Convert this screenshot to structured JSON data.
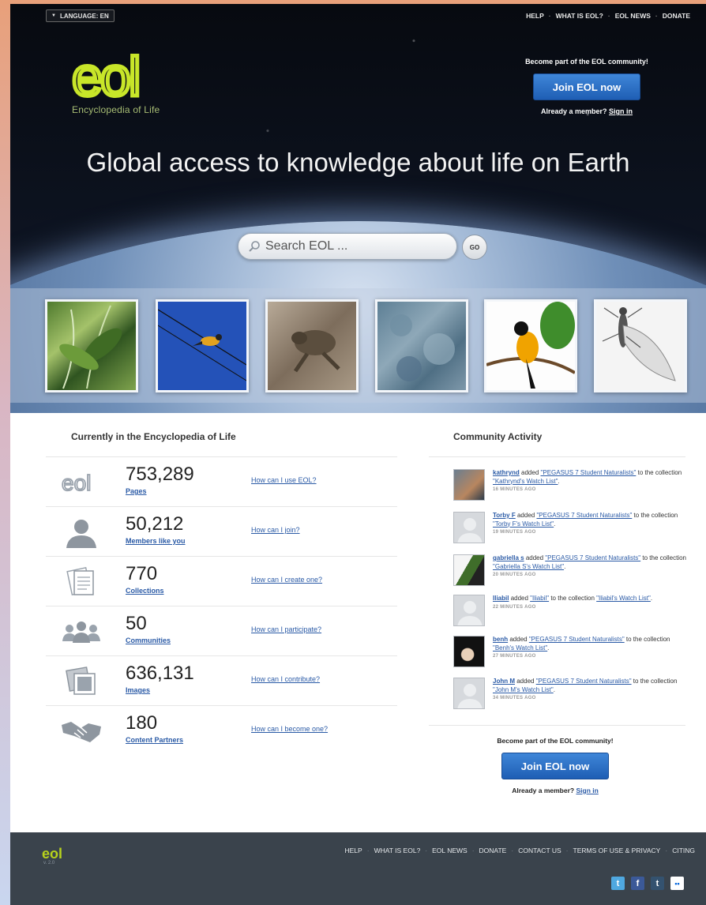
{
  "topbar": {
    "language_label": "LANGUAGE: EN",
    "nav": [
      "HELP",
      "WHAT IS EOL?",
      "EOL NEWS",
      "DONATE"
    ]
  },
  "brand": {
    "logo_text": "eol",
    "subtitle": "Encyclopedia of Life",
    "logo_color": "#c8e629"
  },
  "hero": {
    "cta_text": "Become part of the EOL community!",
    "join_label": "Join EOL now",
    "already_text": "Already a member?",
    "signin_label": "Sign in",
    "tagline": "Global access to knowledge about life on Earth"
  },
  "search": {
    "placeholder": "Search EOL ...",
    "go_label": "GO"
  },
  "stats": {
    "title": "Currently in the Encyclopedia of Life",
    "items": [
      {
        "icon": "eol-logo-icon",
        "number": "753,289",
        "label": "Pages",
        "link": "How can I use EOL?"
      },
      {
        "icon": "member-icon",
        "number": "50,212",
        "label": "Members like you",
        "link": "How can I join?"
      },
      {
        "icon": "collection-icon",
        "number": "770",
        "label": "Collections",
        "link": "How can I create one?"
      },
      {
        "icon": "communities-icon",
        "number": "50",
        "label": "Communities",
        "link": "How can I participate?"
      },
      {
        "icon": "images-icon",
        "number": "636,131",
        "label": "Images",
        "link": "How can I contribute?"
      },
      {
        "icon": "handshake-icon",
        "number": "180",
        "label": "Content Partners",
        "link": "How can I become one?"
      }
    ]
  },
  "community": {
    "title": "Community Activity",
    "items": [
      {
        "user": "kathrynd",
        "added": "added",
        "item": "\"PEGASUS 7 Student Naturalists\"",
        "mid": "to the collection",
        "collection": "\"Kathrynd's Watch List\"",
        "end": ".",
        "time": "16 MINUTES AGO"
      },
      {
        "user": "Torby F",
        "added": "added",
        "item": "\"PEGASUS 7 Student Naturalists\"",
        "mid": "to the collection",
        "collection": "\"Torby F's Watch List\"",
        "end": ".",
        "time": "19 MINUTES AGO"
      },
      {
        "user": "gabriella s",
        "added": "added",
        "item": "\"PEGASUS 7 Student Naturalists\"",
        "mid": "to the collection",
        "collection": "\"Gabriella S's Watch List\"",
        "end": ".",
        "time": "20 MINUTES AGO"
      },
      {
        "user": "Iliabil",
        "added": "added",
        "item": "\"Iliabil\"",
        "mid": "to the collection",
        "collection": "\"Iliabil's Watch List\"",
        "end": ".",
        "time": "22 MINUTES AGO"
      },
      {
        "user": "benh",
        "added": "added",
        "item": "\"PEGASUS 7 Student Naturalists\"",
        "mid": "to the collection",
        "collection": "\"Benh's Watch List\"",
        "end": ".",
        "time": "27 MINUTES AGO"
      },
      {
        "user": "John M",
        "added": "added",
        "item": "\"PEGASUS 7 Student Naturalists\"",
        "mid": "to the collection",
        "collection": "\"John M's Watch List\"",
        "end": ".",
        "time": "34 MINUTES AGO"
      }
    ],
    "cta_text": "Become part of the EOL community!",
    "join_label": "Join EOL now",
    "already_text": "Already a member?",
    "signin_label": "Sign in"
  },
  "footer": {
    "logo_text": "eol",
    "version": "v. 2.0",
    "nav": [
      "HELP",
      "WHAT IS EOL?",
      "EOL NEWS",
      "DONATE",
      "CONTACT US",
      "TERMS OF USE & PRIVACY",
      "CITING"
    ],
    "social": [
      {
        "name": "twitter-icon",
        "glyph": "t",
        "color": "#4fa8e0"
      },
      {
        "name": "facebook-icon",
        "glyph": "f",
        "color": "#3b5998"
      },
      {
        "name": "tumblr-icon",
        "glyph": "t",
        "color": "#34526f"
      },
      {
        "name": "flickr-icon",
        "glyph": "••",
        "color": "#ffffff"
      }
    ]
  }
}
